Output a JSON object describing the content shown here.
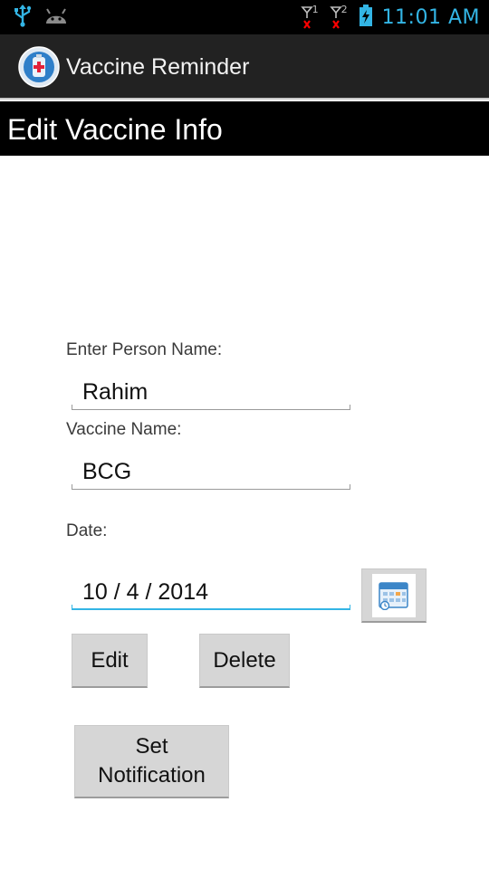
{
  "status_bar": {
    "time": "11:01 AM",
    "sim1_label": "1",
    "sim2_label": "2",
    "icons": [
      "usb-icon",
      "android-icon",
      "signal-sim1-icon",
      "signal-sim2-icon",
      "battery-charging-icon"
    ]
  },
  "action_bar": {
    "title": "Vaccine Reminder",
    "app_icon": "vaccine-app-icon"
  },
  "header": {
    "title": "Edit Vaccine Info"
  },
  "form": {
    "person_label": "Enter Person Name:",
    "person_value": "Rahim",
    "vaccine_label": "Vaccine Name:",
    "vaccine_value": "BCG",
    "date_label": "Date:",
    "date_value": "10 / 4 / 2014",
    "calendar_icon": "calendar-icon"
  },
  "buttons": {
    "edit_label": "Edit",
    "delete_label": "Delete",
    "notify_line1": "Set",
    "notify_line2": "Notification"
  },
  "colors": {
    "accent": "#33b5e5",
    "status_bar_bg": "#000000",
    "action_bar_bg": "#222222",
    "header_bg": "#000000",
    "button_bg": "#d6d6d6",
    "signal_error": "#ff0000"
  }
}
